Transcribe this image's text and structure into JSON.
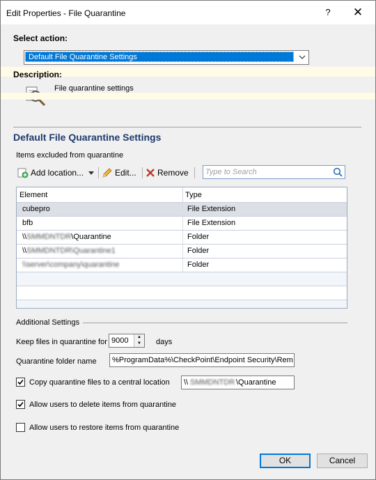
{
  "window": {
    "title": "Edit Properties - File Quarantine",
    "help_glyph": "?",
    "close_glyph": "✕"
  },
  "select_action": {
    "label": "Select action:",
    "value": "Default File Quarantine Settings"
  },
  "description": {
    "label": "Description:",
    "text": "File quarantine settings",
    "icon": "magnifier-document-icon"
  },
  "section": {
    "title": "Default File Quarantine Settings",
    "items_label": "Items excluded from quarantine"
  },
  "toolbar": {
    "add_label": "Add location...",
    "edit_label": "Edit...",
    "remove_label": "Remove",
    "search_placeholder": "Type to Search"
  },
  "table": {
    "headers": [
      "Element",
      "Type"
    ],
    "rows": [
      {
        "element": "cubepro",
        "type": "File Extension"
      },
      {
        "element": "bfb",
        "type": "File Extension"
      },
      {
        "element": "\\\\",
        "element_suffix": "\\Quarantine",
        "element_redacted": "SMMDNTDR",
        "type": "Folder"
      },
      {
        "element": "\\\\",
        "element_redacted": "SMMDNTDR\\Quarantine1",
        "type": "Folder"
      },
      {
        "element": "",
        "element_redacted": "\\\\server\\company\\quarantine",
        "type": "Folder"
      }
    ]
  },
  "additional": {
    "label": "Additional Settings",
    "keep_label": "Keep files in quarantine for",
    "keep_value": "9000",
    "keep_unit": "days",
    "folder_label": "Quarantine folder name",
    "folder_value": "%ProgramData%\\CheckPoint\\Endpoint Security\\Remediation\\Quarantine",
    "copy_label": "Copy quarantine files to a central location",
    "copy_checked": true,
    "copy_value_prefix": "\\\\",
    "copy_value_redacted": "SMMDNTDR",
    "copy_value_suffix": "\\Quarantine",
    "allow_delete_label": "Allow users to delete items from quarantine",
    "allow_delete_checked": true,
    "allow_restore_label": "Allow users to restore items from quarantine",
    "allow_restore_checked": false
  },
  "buttons": {
    "ok": "OK",
    "cancel": "Cancel"
  },
  "colors": {
    "selection": "#0078d7",
    "section_title": "#1f3a6e",
    "remove_x": "#c0392b"
  }
}
